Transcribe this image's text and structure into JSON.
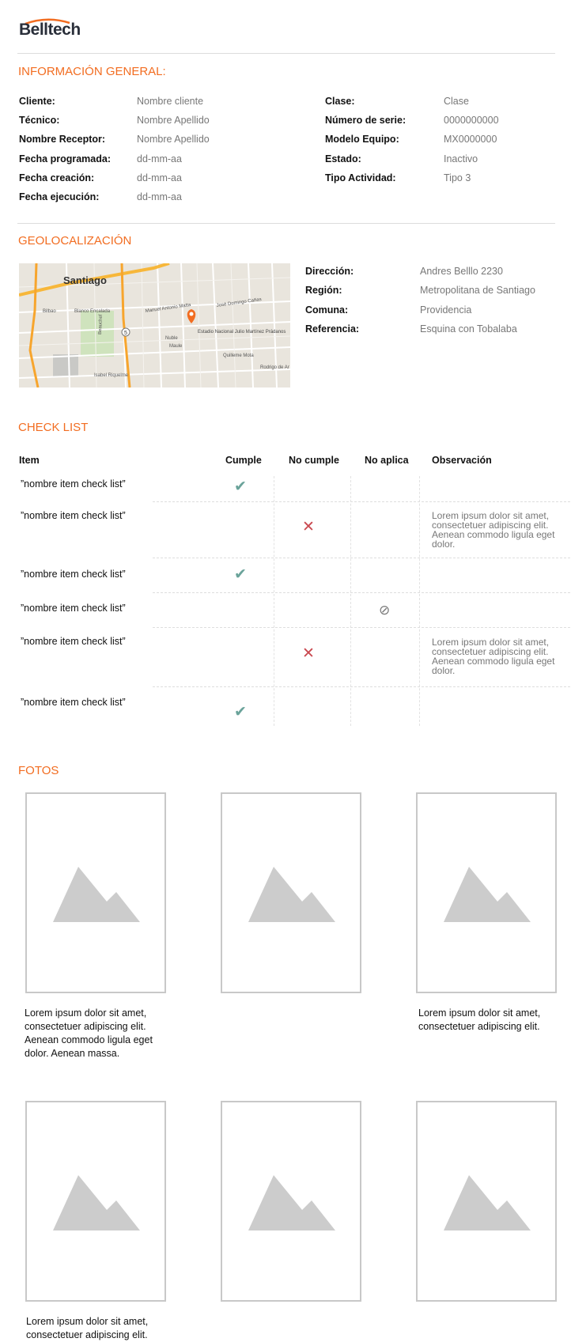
{
  "brand": {
    "name": "Belltech",
    "accent": "#f26d21"
  },
  "general": {
    "title": "INFORMACIÓN GENERAL:",
    "left": [
      {
        "label": "Cliente:",
        "value": "Nombre cliente"
      },
      {
        "label": "Técnico:",
        "value": "Nombre Apellido"
      },
      {
        "label": "Nombre Receptor:",
        "value": "Nombre Apellido"
      },
      {
        "label": "Fecha programada:",
        "value": "dd-mm-aa"
      },
      {
        "label": "Fecha creación:",
        "value": "dd-mm-aa"
      },
      {
        "label": "Fecha ejecución:",
        "value": "dd-mm-aa"
      }
    ],
    "right": [
      {
        "label": "Clase:",
        "value": "Clase"
      },
      {
        "label": "Número de serie:",
        "value": "0000000000"
      },
      {
        "label": "Modelo Equipo:",
        "value": "MX0000000"
      },
      {
        "label": "Estado:",
        "value": "Inactivo"
      },
      {
        "label": "Tipo Actividad:",
        "value": "Tipo 3"
      }
    ]
  },
  "geo": {
    "title": "GEOLOCALIZACIÓN",
    "fields": [
      {
        "label": "Dirección:",
        "value": "Andres Belllo 2230"
      },
      {
        "label": "Región:",
        "value": "Metropolitana de Santiago"
      },
      {
        "label": "Comuna:",
        "value": "Providencia"
      },
      {
        "label": "Referencia:",
        "value": "Esquina con Tobalaba"
      }
    ],
    "map": {
      "city": "Santiago",
      "labels": [
        "Blanco Encalada",
        "Beauchef",
        "Manuel Antonio Matta",
        "José Domingo Cañas",
        "Estadio Nacional Julio Martínez Prádanos",
        "Quilleme Mota",
        "Rodrigo de Ar",
        "Isabel Riquelme",
        "Bilbao",
        "Nuble",
        "Maule"
      ],
      "route": "5"
    }
  },
  "checklist": {
    "title": "CHECK LIST",
    "headers": {
      "item": "Item",
      "cumple": "Cumple",
      "no_cumple": "No cumple",
      "no_aplica": "No aplica",
      "observacion": "Observación"
    },
    "rows": [
      {
        "name": "”nombre item check list”",
        "status": "cumple",
        "observation": ""
      },
      {
        "name": "”nombre item check list”",
        "status": "no_cumple",
        "observation": "Lorem ipsum dolor sit amet, consectetuer adipiscing elit. Aenean commodo ligula eget dolor."
      },
      {
        "name": "”nombre item check list”",
        "status": "cumple",
        "observation": ""
      },
      {
        "name": "”nombre item check list”",
        "status": "no_aplica",
        "observation": ""
      },
      {
        "name": "”nombre item check list”",
        "status": "no_cumple",
        "observation": "Lorem ipsum dolor sit amet, consectetuer adipiscing elit. Aenean commodo ligula eget dolor."
      },
      {
        "name": "”nombre item check list”",
        "status": "cumple",
        "observation": ""
      }
    ],
    "icons": {
      "cumple": "check-icon",
      "no_cumple": "cross-icon",
      "no_aplica": "not-applicable-icon"
    },
    "colors": {
      "ok": "#6aa39a",
      "bad": "#c9484f"
    }
  },
  "photos": {
    "title": "FOTOS",
    "items": [
      {
        "caption": "Lorem ipsum dolor sit amet, consectetuer adipiscing elit. Aenean commodo ligula eget dolor. Aenean massa."
      },
      {
        "caption": ""
      },
      {
        "caption": "Lorem ipsum dolor sit amet, consectetuer adipiscing elit."
      },
      {
        "caption": "Lorem ipsum dolor sit amet, consectetuer adipiscing elit."
      },
      {
        "caption": ""
      },
      {
        "caption": ""
      }
    ]
  }
}
